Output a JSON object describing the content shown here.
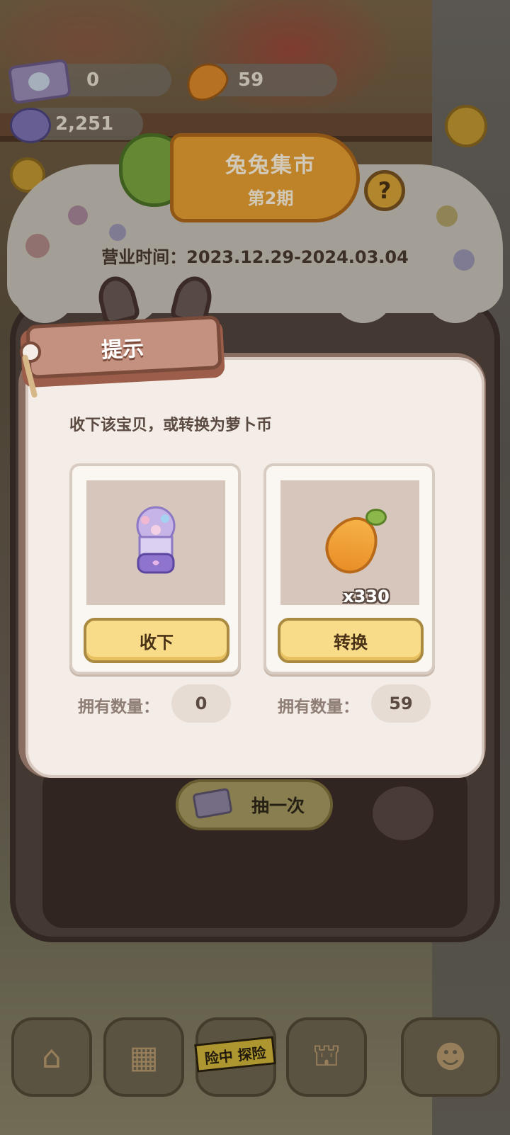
{
  "hud": {
    "tickets": "0",
    "carrots": "59",
    "gems": "2,251"
  },
  "banner": {
    "title": "兔兔集市",
    "issue": "第2期",
    "help": "?"
  },
  "shop": {
    "hours": "营业时间：2023.12.29-2024.03.04",
    "draw_label": "抽一次"
  },
  "dialog": {
    "tag": "提示",
    "prompt": "收下该宝贝，或转换为萝卜币",
    "item": {
      "accept_label": "收下",
      "own_label": "拥有数量：",
      "own_count": "0"
    },
    "carrot": {
      "qty": "x330",
      "convert_label": "转换",
      "own_label": "拥有数量：",
      "own_count": "59"
    }
  },
  "nav": {
    "explore_tag": "险中 探险"
  },
  "colors": {
    "dialog_bg": "#f4ece6",
    "button_yellow": "#f8dc8a",
    "tag_brown": "#c49080"
  }
}
